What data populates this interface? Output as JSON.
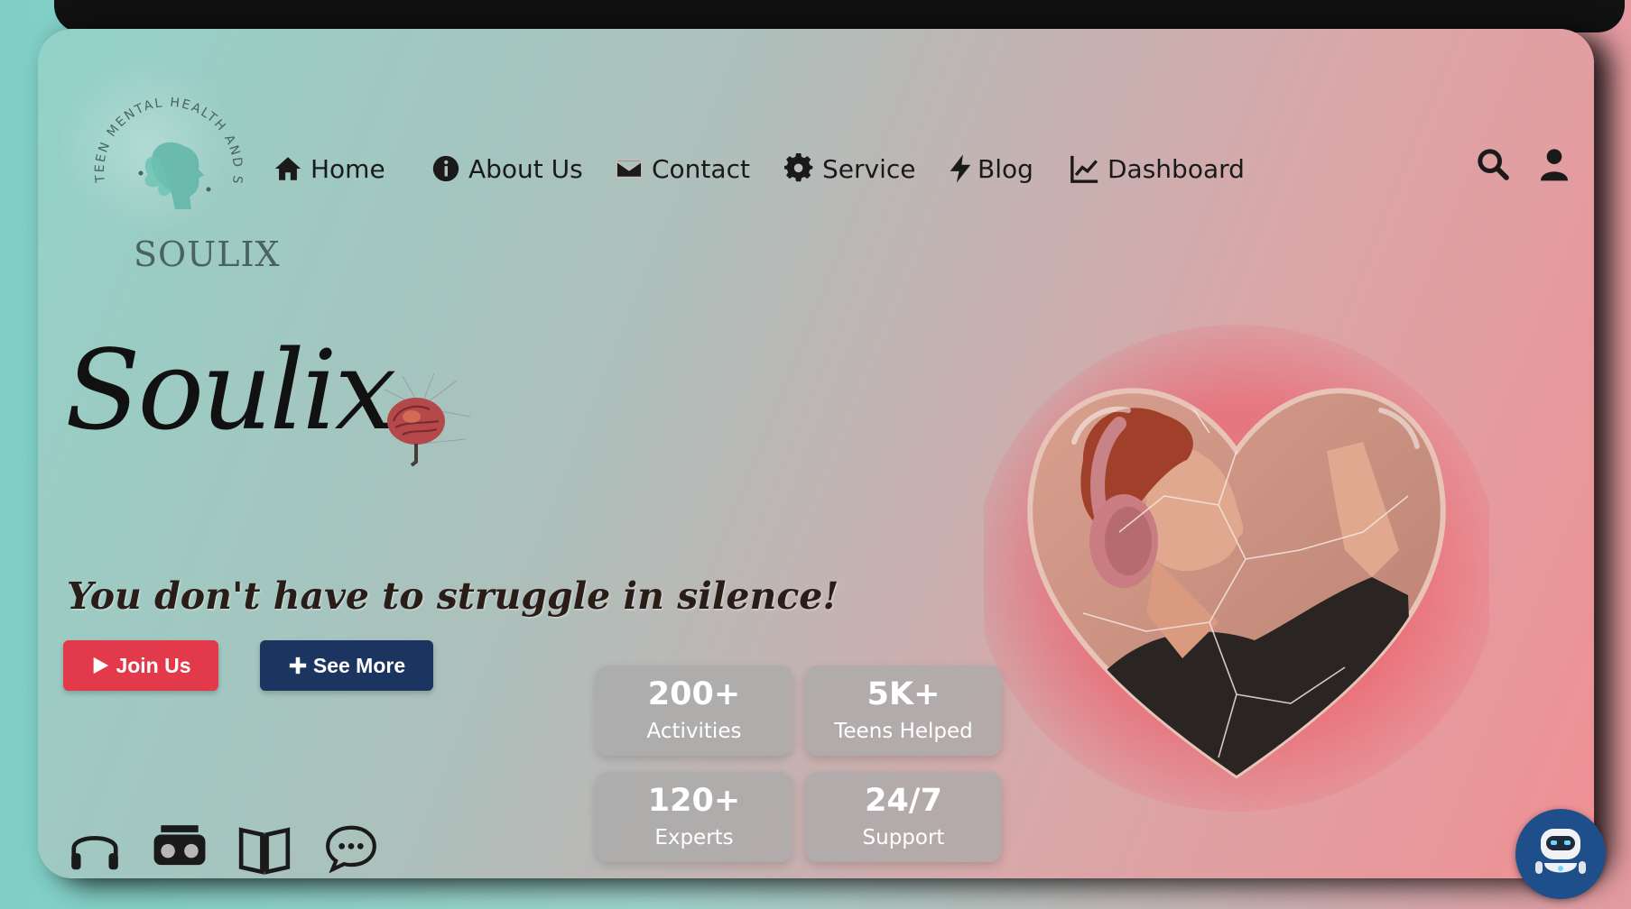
{
  "logo": {
    "arc_text": "TEEN MENTAL HEALTH AND SUPPORT",
    "wordmark": "SOULIX"
  },
  "nav": {
    "items": [
      {
        "label": "Home",
        "icon": "home-icon"
      },
      {
        "label": "About Us",
        "icon": "info-circle-icon"
      },
      {
        "label": "Contact",
        "icon": "envelope-icon"
      },
      {
        "label": "Service",
        "icon": "gear-icon"
      },
      {
        "label": "Blog",
        "icon": "bolt-icon"
      },
      {
        "label": "Dashboard",
        "icon": "line-chart-icon"
      }
    ],
    "actions": [
      "search-icon",
      "user-icon"
    ]
  },
  "hero": {
    "brand": "Soulix",
    "tagline": "You don't have to struggle in silence!",
    "buttons": {
      "join": "Join Us",
      "see_more": "See More"
    }
  },
  "stats": [
    {
      "value": "200+",
      "label": "Activities"
    },
    {
      "value": "5K+",
      "label": "Teens Helped"
    },
    {
      "value": "120+",
      "label": "Experts"
    },
    {
      "value": "24/7",
      "label": "Support"
    }
  ],
  "features": [
    "headphones-icon",
    "vr-headset-icon",
    "book-icon",
    "chat-bubble-icon"
  ],
  "colors": {
    "join_button": "#e23a4a",
    "see_more_button": "#1c3560",
    "chatbot": "#1e4f8a"
  }
}
